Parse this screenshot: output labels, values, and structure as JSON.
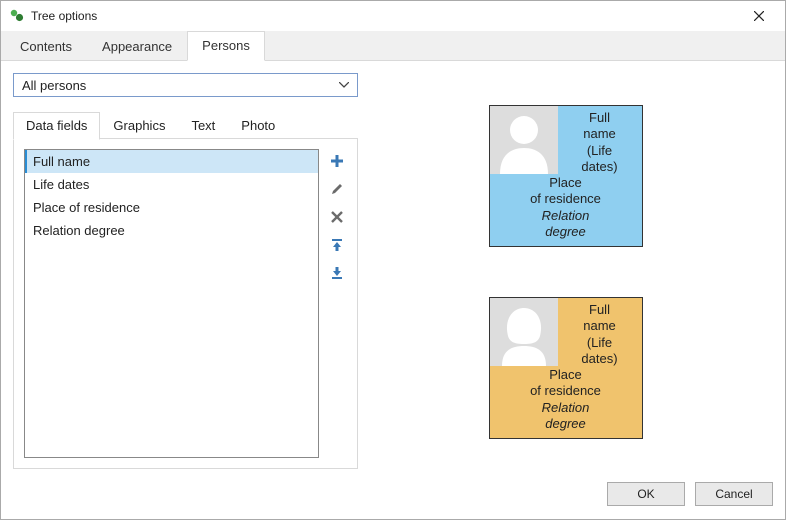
{
  "window": {
    "title": "Tree options"
  },
  "tabs": {
    "items": [
      {
        "label": "Contents",
        "active": false
      },
      {
        "label": "Appearance",
        "active": false
      },
      {
        "label": "Persons",
        "active": true
      }
    ]
  },
  "scope_dropdown": {
    "value": "All persons"
  },
  "subtabs": {
    "items": [
      {
        "label": "Data fields",
        "active": true
      },
      {
        "label": "Graphics",
        "active": false
      },
      {
        "label": "Text",
        "active": false
      },
      {
        "label": "Photo",
        "active": false
      }
    ]
  },
  "fields_list": {
    "items": [
      {
        "label": "Full name",
        "selected": true
      },
      {
        "label": "Life dates",
        "selected": false
      },
      {
        "label": "Place of residence",
        "selected": false
      },
      {
        "label": "Relation degree",
        "selected": false
      }
    ]
  },
  "tool_icons": {
    "add": "plus-icon",
    "edit": "pencil-icon",
    "delete": "x-icon",
    "move_up": "arrow-up-bar-icon",
    "move_down": "arrow-down-bar-icon"
  },
  "preview": {
    "card_lines": {
      "name_l1": "Full",
      "name_l2": "name",
      "dates_l1": "(Life",
      "dates_l2": "dates)",
      "place_l1": "Place",
      "place_l2": "of residence",
      "rel_l1": "Relation",
      "rel_l2": "degree"
    },
    "male_color": "#8fcff0",
    "female_color": "#f0c36d"
  },
  "buttons": {
    "ok": "OK",
    "cancel": "Cancel"
  }
}
